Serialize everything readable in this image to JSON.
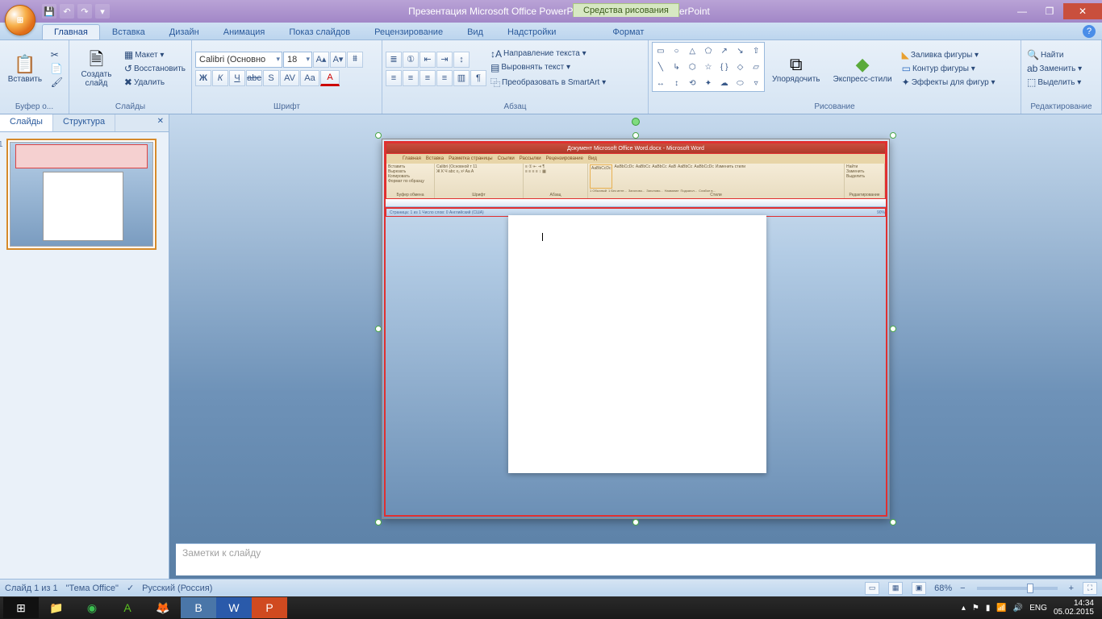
{
  "titlebar": {
    "title": "Презентация Microsoft Office PowerPoint.pptx - Microsoft PowerPoint",
    "context_tab": "Средства рисования",
    "qat": {
      "save": "💾",
      "undo": "↶",
      "redo": "↷",
      "more": "▾"
    }
  },
  "tabs": {
    "home": "Главная",
    "insert": "Вставка",
    "design": "Дизайн",
    "animation": "Анимация",
    "slideshow": "Показ слайдов",
    "review": "Рецензирование",
    "view": "Вид",
    "addins": "Надстройки",
    "format": "Формат"
  },
  "ribbon": {
    "clipboard": {
      "label": "Буфер о...",
      "paste": "Вставить",
      "cut": "✂",
      "copy": "📄",
      "painter": "🖌"
    },
    "slides": {
      "label": "Слайды",
      "new_slide": "Создать\nслайд",
      "layout": "Макет ▾",
      "reset": "Восстановить",
      "delete": "Удалить"
    },
    "font": {
      "label": "Шрифт",
      "family": "Calibri (Основно",
      "size": "18",
      "bold": "Ж",
      "italic": "К",
      "underline": "Ч",
      "strike": "abc",
      "shadow": "S",
      "spacing": "AV",
      "case": "Aa",
      "clear": "⩩",
      "color": "A",
      "grow": "A▴",
      "shrink": "A▾"
    },
    "paragraph": {
      "label": "Абзац",
      "bullets": "≣",
      "numbers": "①",
      "indent_out": "⇤",
      "indent_in": "⇥",
      "line_spacing": "↕",
      "align_l": "≡",
      "align_c": "≡",
      "align_r": "≡",
      "justify": "≡",
      "columns": "▥",
      "ltr": "¶",
      "text_dir": "Направление текста ▾",
      "align_text": "Выровнять текст ▾",
      "smartart": "Преобразовать в SmartArt ▾"
    },
    "drawing": {
      "label": "Рисование",
      "arrange": "Упорядочить",
      "quick_styles": "Экспресс-стили",
      "fill": "Заливка фигуры ▾",
      "outline": "Контур фигуры ▾",
      "effects": "Эффекты для фигур ▾"
    },
    "editing": {
      "label": "Редактирование",
      "find": "Найти",
      "replace": "Заменить ▾",
      "select": "Выделить ▾"
    }
  },
  "slidepanel": {
    "slides_tab": "Слайды",
    "outline_tab": "Структура",
    "close": "✕",
    "thumb_number": "1"
  },
  "notes": {
    "placeholder": "Заметки к слайду"
  },
  "word_embed": {
    "title": "Документ Microsoft Office Word.docx - Microsoft Word",
    "tabs": [
      "Главная",
      "Вставка",
      "Разметка страницы",
      "Ссылки",
      "Рассылки",
      "Рецензирование",
      "Вид"
    ],
    "clipboard": {
      "label": "Буфер обмена",
      "paste": "Вставить",
      "cut": "Вырезать",
      "copy": "Копировать",
      "painter": "Формат по образцу"
    },
    "font": {
      "label": "Шрифт",
      "family": "Calibri (Основной т",
      "size": "11"
    },
    "paragraph": {
      "label": "Абзац"
    },
    "styles": {
      "label": "Стили",
      "items": [
        "AaBbCcDc",
        "AaBbCcDc",
        "AaBbCc",
        "AaBbCc",
        "AaB",
        "AaBbCc",
        "AaBbCcDc"
      ],
      "names": [
        "1 Обычный",
        "1 Без инте...",
        "Заголово...",
        "Заголово...",
        "Название",
        "Подзагол...",
        "Слабое в..."
      ],
      "change": "Изменить\nстили"
    },
    "editing": {
      "label": "Редактирование",
      "find": "Найти",
      "replace": "Заменить",
      "select": "Выделить"
    },
    "status": "Страница: 1 из 1   Число слов: 0   Английский (США)",
    "zoom": "90%"
  },
  "statusbar": {
    "slide_info": "Слайд 1 из 1",
    "theme": "\"Тема Office\"",
    "language": "Русский (Россия)",
    "zoom": "68%"
  },
  "taskbar": {
    "lang": "ENG",
    "time": "14:34",
    "date": "05.02.2015"
  }
}
